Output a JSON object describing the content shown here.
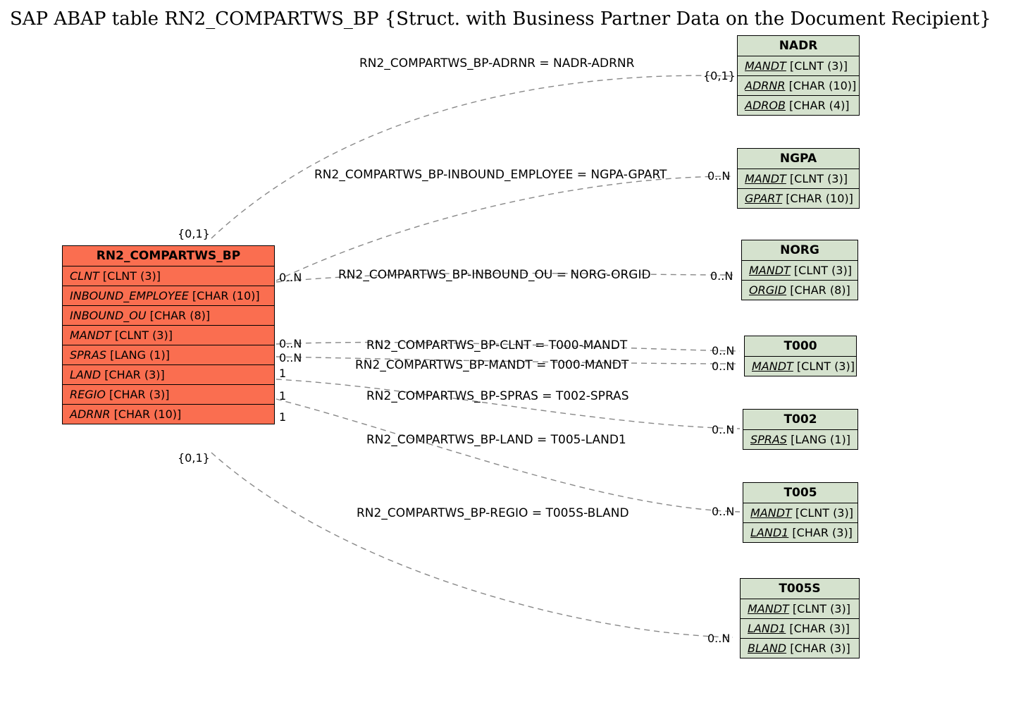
{
  "title": "SAP ABAP table RN2_COMPARTWS_BP {Struct. with Business Partner Data on the Document Recipient}",
  "main": {
    "name": "RN2_COMPARTWS_BP",
    "fields": [
      {
        "n": "CLNT",
        "t": "[CLNT (3)]",
        "u": 0
      },
      {
        "n": "INBOUND_EMPLOYEE",
        "t": "[CHAR (10)]",
        "u": 0
      },
      {
        "n": "INBOUND_OU",
        "t": "[CHAR (8)]",
        "u": 0
      },
      {
        "n": "MANDT",
        "t": "[CLNT (3)]",
        "u": 0
      },
      {
        "n": "SPRAS",
        "t": "[LANG (1)]",
        "u": 0
      },
      {
        "n": "LAND",
        "t": "[CHAR (3)]",
        "u": 0
      },
      {
        "n": "REGIO",
        "t": "[CHAR (3)]",
        "u": 0
      },
      {
        "n": "ADRNR",
        "t": "[CHAR (10)]",
        "u": 0
      }
    ]
  },
  "refs": [
    {
      "id": "nadr",
      "name": "NADR",
      "fields": [
        {
          "n": "MANDT",
          "t": "[CLNT (3)]",
          "u": 1
        },
        {
          "n": "ADRNR",
          "t": "[CHAR (10)]",
          "u": 1
        },
        {
          "n": "ADROB",
          "t": "[CHAR (4)]",
          "u": 1
        }
      ]
    },
    {
      "id": "ngpa",
      "name": "NGPA",
      "fields": [
        {
          "n": "MANDT",
          "t": "[CLNT (3)]",
          "u": 1
        },
        {
          "n": "GPART",
          "t": "[CHAR (10)]",
          "u": 1
        }
      ]
    },
    {
      "id": "norg",
      "name": "NORG",
      "fields": [
        {
          "n": "MANDT",
          "t": "[CLNT (3)]",
          "u": 1
        },
        {
          "n": "ORGID",
          "t": "[CHAR (8)]",
          "u": 1
        }
      ]
    },
    {
      "id": "t000",
      "name": "T000",
      "fields": [
        {
          "n": "MANDT",
          "t": "[CLNT (3)]",
          "u": 1
        }
      ]
    },
    {
      "id": "t002",
      "name": "T002",
      "fields": [
        {
          "n": "SPRAS",
          "t": "[LANG (1)]",
          "u": 1
        }
      ]
    },
    {
      "id": "t005",
      "name": "T005",
      "fields": [
        {
          "n": "MANDT",
          "t": "[CLNT (3)]",
          "u": 1
        },
        {
          "n": "LAND1",
          "t": "[CHAR (3)]",
          "u": 1
        }
      ]
    },
    {
      "id": "t005s",
      "name": "T005S",
      "fields": [
        {
          "n": "MANDT",
          "t": "[CLNT (3)]",
          "u": 1
        },
        {
          "n": "LAND1",
          "t": "[CHAR (3)]",
          "u": 1
        },
        {
          "n": "BLAND",
          "t": "[CHAR (3)]",
          "u": 1
        }
      ]
    }
  ],
  "rels": [
    {
      "lbl": "RN2_COMPARTWS_BP-ADRNR = NADR-ADRNR",
      "lc": "{0,1}",
      "rc": "{0,1}"
    },
    {
      "lbl": "RN2_COMPARTWS_BP-INBOUND_EMPLOYEE = NGPA-GPART",
      "lc": "0..N",
      "rc": "0..N"
    },
    {
      "lbl": "RN2_COMPARTWS_BP-INBOUND_OU = NORG-ORGID",
      "lc": "0..N",
      "rc": "0..N"
    },
    {
      "lbl": "RN2_COMPARTWS_BP-CLNT = T000-MANDT",
      "lc": "0..N",
      "rc": "0..N"
    },
    {
      "lbl": "RN2_COMPARTWS_BP-MANDT = T000-MANDT",
      "lc": "0..N",
      "rc": "0..N"
    },
    {
      "lbl": "RN2_COMPARTWS_BP-SPRAS = T002-SPRAS",
      "lc": "1",
      "rc": "0..N"
    },
    {
      "lbl": "RN2_COMPARTWS_BP-LAND = T005-LAND1",
      "lc": "1",
      "rc": "0..N"
    },
    {
      "lbl": "RN2_COMPARTWS_BP-REGIO = T005S-BLAND",
      "lc": "1",
      "rc": "0..N"
    }
  ],
  "extra_card_bottom": "{0,1}"
}
